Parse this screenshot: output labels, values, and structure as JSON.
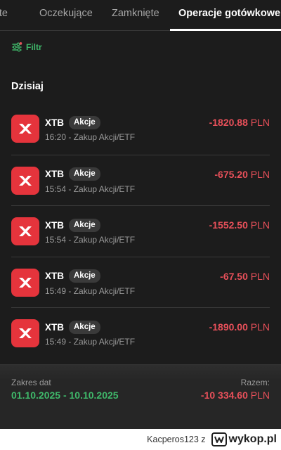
{
  "tabs": [
    {
      "label": "rte",
      "active": false
    },
    {
      "label": "Oczekujące",
      "active": false
    },
    {
      "label": "Zamknięte",
      "active": false
    },
    {
      "label": "Operacje gotówkowe",
      "active": true
    }
  ],
  "filter": {
    "label": "Filtr",
    "icon": "sliders-icon"
  },
  "section": {
    "title": "Dzisiaj"
  },
  "transactions": [
    {
      "broker": "XTB",
      "badge": "Akcje",
      "time": "16:20",
      "description": "Zakup Akcji/ETF",
      "amount": "-1820.88",
      "currency": "PLN"
    },
    {
      "broker": "XTB",
      "badge": "Akcje",
      "time": "15:54",
      "description": "Zakup Akcji/ETF",
      "amount": "-675.20",
      "currency": "PLN"
    },
    {
      "broker": "XTB",
      "badge": "Akcje",
      "time": "15:54",
      "description": "Zakup Akcji/ETF",
      "amount": "-1552.50",
      "currency": "PLN"
    },
    {
      "broker": "XTB",
      "badge": "Akcje",
      "time": "15:49",
      "description": "Zakup Akcji/ETF",
      "amount": "-67.50",
      "currency": "PLN"
    },
    {
      "broker": "XTB",
      "badge": "Akcje",
      "time": "15:49",
      "description": "Zakup Akcji/ETF",
      "amount": "-1890.00",
      "currency": "PLN"
    }
  ],
  "footer": {
    "range_label": "Zakres dat",
    "range_value": "01.10.2025 - 10.10.2025",
    "total_label": "Razem:",
    "total_value": "-10 334.60",
    "total_currency": "PLN"
  },
  "watermark": {
    "user": "Kacperos123 z",
    "brand": "wykop.pl"
  },
  "colors": {
    "background": "#1c1c1c",
    "accent_green": "#3fb86a",
    "negative_red": "#e8505a",
    "logo_red": "#e5343c",
    "badge_bg": "#3a3a3a"
  }
}
